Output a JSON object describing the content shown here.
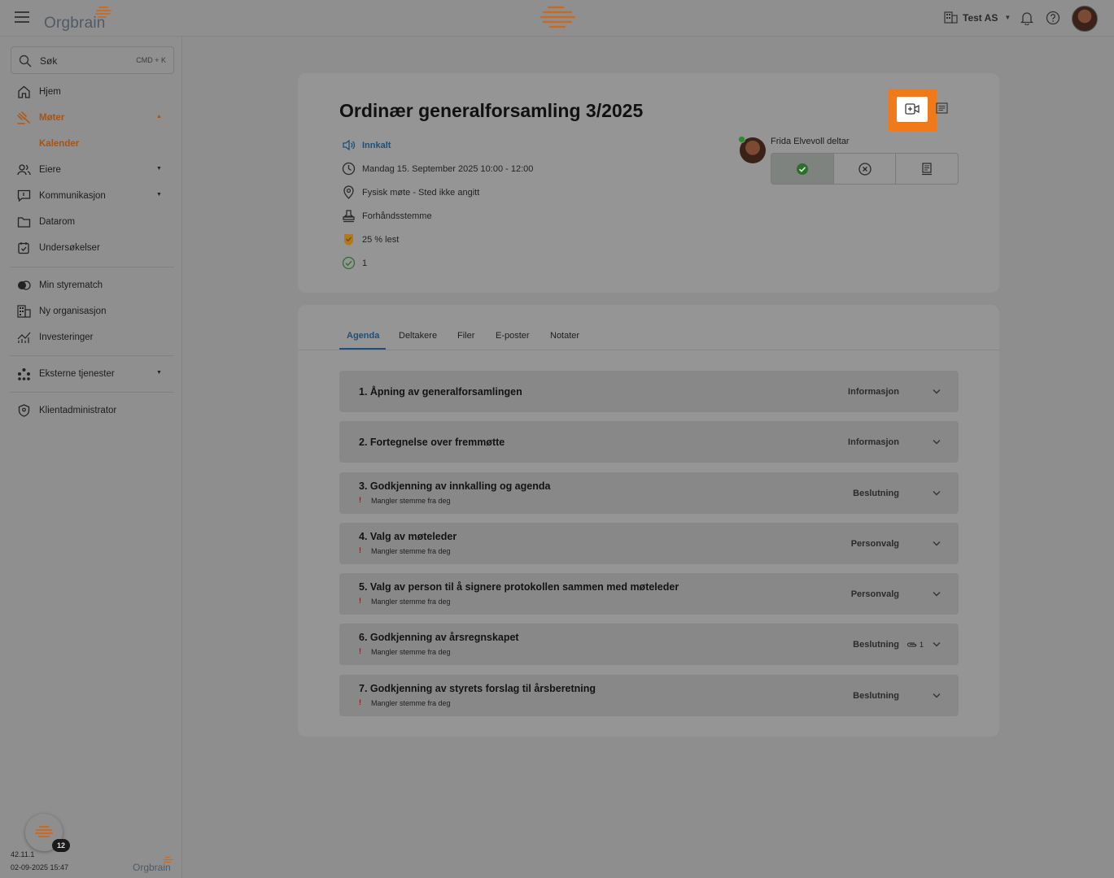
{
  "header": {
    "app_name": "Orgbrain",
    "org_name": "Test AS"
  },
  "sidebar": {
    "search_label": "Søk",
    "search_shortcut": "CMD + K",
    "items": [
      {
        "label": "Hjem"
      },
      {
        "label": "Møter"
      },
      {
        "label": "Kalender"
      },
      {
        "label": "Eiere"
      },
      {
        "label": "Kommunikasjon"
      },
      {
        "label": "Datarom"
      },
      {
        "label": "Undersøkelser"
      },
      {
        "label": "Min styrematch"
      },
      {
        "label": "Ny organisasjon"
      },
      {
        "label": "Investeringer"
      },
      {
        "label": "Eksterne tjenester"
      },
      {
        "label": "Klientadministrator"
      }
    ],
    "chat_badge": "12",
    "version": "42.11.1",
    "datetime": "02-09-2025 15:47",
    "footer_logo": "Orgbrain"
  },
  "meeting": {
    "title": "Ordinær generalforsamling 3/2025",
    "status": "Innkalt",
    "datetime": "Mandag 15. September 2025 10:00 - 12:00",
    "location": "Fysisk møte - Sted ikke angitt",
    "voting": "Forhåndsstemme",
    "read_percent": "25 % lest",
    "approved_count": "1",
    "participant": "Frida Elvevoll deltar"
  },
  "tabs": [
    "Agenda",
    "Deltakere",
    "Filer",
    "E-poster",
    "Notater"
  ],
  "agenda": [
    {
      "title": "1. Åpning av generalforsamlingen",
      "type": "Informasjon",
      "warning": ""
    },
    {
      "title": "2. Fortegnelse over fremmøtte",
      "type": "Informasjon",
      "warning": ""
    },
    {
      "title": "3. Godkjenning av innkalling og agenda",
      "type": "Beslutning",
      "warning": "Mangler stemme fra deg"
    },
    {
      "title": "4. Valg av møteleder",
      "type": "Personvalg",
      "warning": "Mangler stemme fra deg"
    },
    {
      "title": "5. Valg av person til å signere protokollen sammen med møteleder",
      "type": "Personvalg",
      "warning": "Mangler stemme fra deg"
    },
    {
      "title": "6. Godkjenning av årsregnskapet",
      "type": "Beslutning",
      "warning": "Mangler stemme fra deg",
      "attachments": "1"
    },
    {
      "title": "7. Godkjenning av styrets forslag til årsberetning",
      "type": "Beslutning",
      "warning": "Mangler stemme fra deg"
    }
  ],
  "colors": {
    "accent_orange": "#f07a1a",
    "link_blue": "#1f4f78",
    "active_nav": "#a65316"
  }
}
